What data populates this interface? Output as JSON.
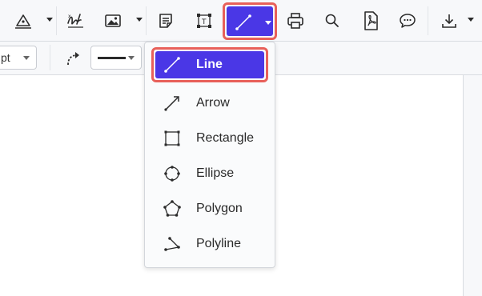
{
  "toolbar": {
    "tools": [
      {
        "icon": "pen-nib-icon"
      },
      {
        "icon": "signature-icon"
      },
      {
        "icon": "image-icon"
      },
      {
        "icon": "note-icon"
      },
      {
        "icon": "text-box-icon"
      },
      {
        "icon": "line-icon",
        "active": true
      },
      {
        "icon": "print-icon"
      },
      {
        "icon": "search-icon"
      },
      {
        "icon": "pdf-icon"
      },
      {
        "icon": "comment-icon"
      },
      {
        "icon": "download-icon"
      }
    ],
    "accent_color": "#4a37e6",
    "highlight_color": "#e8605a"
  },
  "subbar": {
    "font_size_value": "pt",
    "line_style": "solid"
  },
  "shape_menu": {
    "items": [
      {
        "label": "Line",
        "icon": "line-icon",
        "selected": true
      },
      {
        "label": "Arrow",
        "icon": "arrow-icon"
      },
      {
        "label": "Rectangle",
        "icon": "rectangle-icon"
      },
      {
        "label": "Ellipse",
        "icon": "ellipse-icon"
      },
      {
        "label": "Polygon",
        "icon": "polygon-icon"
      },
      {
        "label": "Polyline",
        "icon": "polyline-icon"
      }
    ]
  }
}
